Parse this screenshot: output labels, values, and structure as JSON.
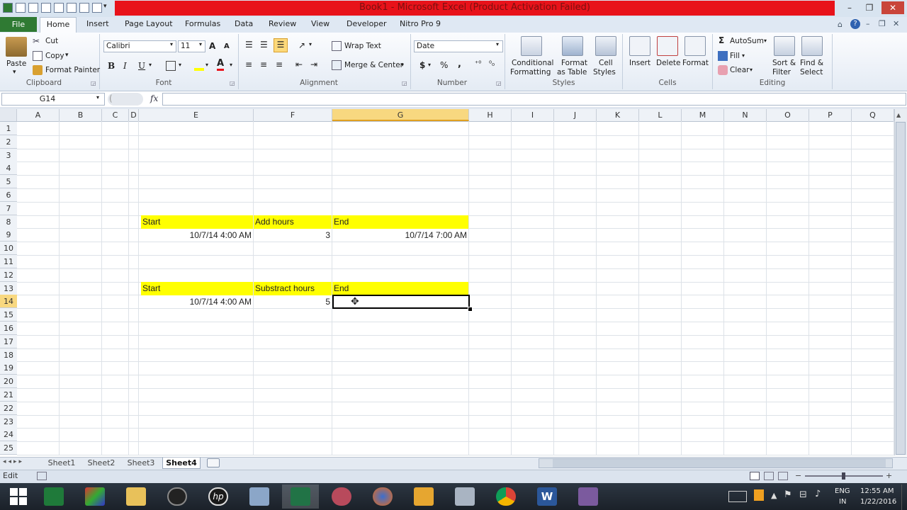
{
  "window": {
    "title": "Book1 - Microsoft Excel (Product Activation Failed)",
    "controls": {
      "minimize": "–",
      "maximize": "❐",
      "close": "✕"
    }
  },
  "ribbon": {
    "tabs": [
      "File",
      "Home",
      "Insert",
      "Page Layout",
      "Formulas",
      "Data",
      "Review",
      "View",
      "Developer",
      "Nitro Pro 9"
    ],
    "active_tab": "Home",
    "clipboard": {
      "paste": "Paste",
      "cut": "Cut",
      "copy": "Copy",
      "format_painter": "Format Painter",
      "label": "Clipboard"
    },
    "font": {
      "name": "Calibri",
      "size": "11",
      "bold": "B",
      "italic": "I",
      "underline": "U",
      "label": "Font"
    },
    "alignment": {
      "wrap_text": "Wrap Text",
      "merge_center": "Merge & Center",
      "label": "Alignment"
    },
    "number": {
      "format": "Date",
      "currency": "$",
      "percent": "%",
      "comma": ",",
      "label": "Number"
    },
    "styles": {
      "conditional_1": "Conditional",
      "conditional_2": "Formatting",
      "format_table_1": "Format",
      "format_table_2": "as Table",
      "cell_styles_1": "Cell",
      "cell_styles_2": "Styles",
      "label": "Styles"
    },
    "cells": {
      "insert": "Insert",
      "delete": "Delete",
      "format": "Format",
      "label": "Cells"
    },
    "editing": {
      "autosum": "AutoSum",
      "fill": "Fill",
      "clear": "Clear",
      "sort_1": "Sort &",
      "sort_2": "Filter",
      "find_1": "Find &",
      "find_2": "Select",
      "label": "Editing"
    }
  },
  "formula_bar": {
    "name_box": "G14",
    "fx": "fx",
    "formula": ""
  },
  "grid": {
    "columns": [
      "A",
      "B",
      "C",
      "D",
      "E",
      "F",
      "G",
      "H",
      "I",
      "J",
      "K",
      "L",
      "M",
      "N",
      "O",
      "P",
      "Q"
    ],
    "rows": [
      "1",
      "2",
      "3",
      "4",
      "5",
      "6",
      "7",
      "8",
      "9",
      "10",
      "11",
      "12",
      "13",
      "14",
      "15",
      "16",
      "17",
      "18",
      "19",
      "20",
      "21",
      "22",
      "23",
      "24",
      "25"
    ],
    "selected_cell": "G14",
    "cells": {
      "E8": "Start",
      "F8": "Add hours",
      "G8": "End",
      "E9": "10/7/14 4:00 AM",
      "F9": "3",
      "G9": "10/7/14 7:00 AM",
      "E13": "Start",
      "F13": "Substract hours",
      "G13": "End",
      "E14": "10/7/14 4:00 AM",
      "F14": "5",
      "G14": ""
    },
    "highlight_color": "#ffff00"
  },
  "sheets": {
    "tabs": [
      "Sheet1",
      "Sheet2",
      "Sheet3",
      "Sheet4"
    ],
    "active": "Sheet4"
  },
  "status": {
    "mode": "Edit"
  },
  "taskbar": {
    "lang_1": "ENG",
    "lang_2": "IN",
    "time": "12:55 AM",
    "date": "1/22/2016",
    "apps": [
      "windows-start",
      "excel",
      "puzzle-app",
      "file-explorer",
      "camera-app",
      "hp",
      "notepad-app",
      "excel-active",
      "media-app",
      "firefox",
      "outlook",
      "calculator",
      "chrome",
      "word",
      "tool-app"
    ]
  },
  "colors": {
    "file_tab": "#2f7a33",
    "title_error": "#e8121a",
    "selection": "#000000"
  }
}
